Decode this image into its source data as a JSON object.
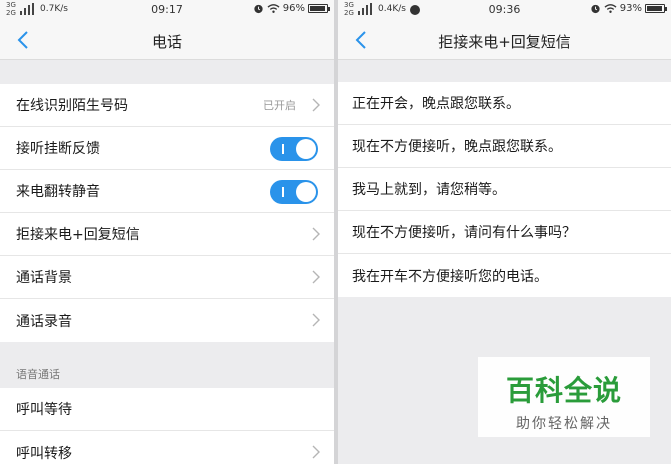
{
  "left": {
    "status": {
      "sim1": "3G",
      "sim2": "2G",
      "speed": "0.7K/s",
      "time": "09:17",
      "battery": "96%"
    },
    "title": "电话",
    "rows": [
      {
        "label": "在线识别陌生号码",
        "value": "已开启"
      },
      {
        "label": "接听挂断反馈",
        "toggle": true
      },
      {
        "label": "来电翻转静音",
        "toggle": true
      },
      {
        "label": "拒接来电+回复短信"
      },
      {
        "label": "通话背景"
      },
      {
        "label": "通话录音"
      }
    ],
    "section": "语音通话",
    "rows2": [
      {
        "label": "呼叫等待"
      },
      {
        "label": "呼叫转移"
      }
    ]
  },
  "right": {
    "status": {
      "sim1": "3G",
      "sim2": "2G",
      "speed": "0.4K/s",
      "time": "09:36",
      "battery": "93%"
    },
    "title": "拒接来电+回复短信",
    "replies": [
      "正在开会，晚点跟您联系。",
      "现在不方便接听，晚点跟您联系。",
      "我马上就到，请您稍等。",
      "现在不方便接听，请问有什么事吗？",
      "我在开车不方便接听您的电话。"
    ]
  },
  "watermark": {
    "title": "百科全说",
    "subtitle": "助你轻松解决"
  },
  "colors": {
    "accent": "#2a93ea",
    "watermark": "#2a9c3a"
  }
}
